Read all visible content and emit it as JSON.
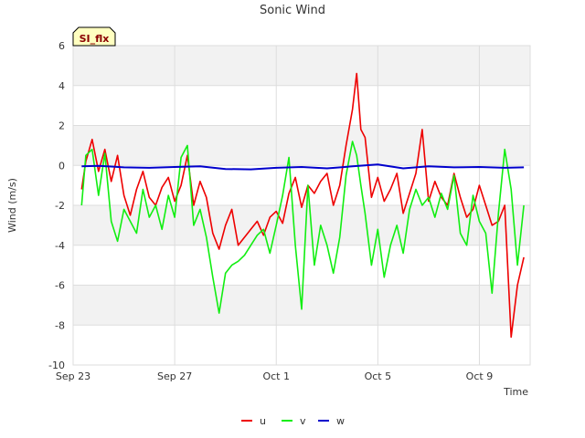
{
  "chart_data": {
    "type": "line",
    "title": "Sonic Wind",
    "xlabel": "Time",
    "ylabel": "Wind (m/s)",
    "badge": "SI_flx",
    "ylim": [
      -10,
      6
    ],
    "yticks": [
      -10,
      -8,
      -6,
      -4,
      -2,
      0,
      2,
      4,
      6
    ],
    "xlim": [
      "2021-09-23",
      "2021-10-11"
    ],
    "xticks": [
      {
        "label": "Sep 23",
        "date": "2021-09-23"
      },
      {
        "label": "Sep 27",
        "date": "2021-09-27"
      },
      {
        "label": "Oct 1",
        "date": "2021-10-01"
      },
      {
        "label": "Oct 5",
        "date": "2021-10-05"
      },
      {
        "label": "Oct 9",
        "date": "2021-10-09"
      }
    ],
    "grid": true,
    "legend_position": "bottom",
    "series": [
      {
        "name": "u",
        "color": "#ee0000",
        "x": [
          "2021-09-23T08:00",
          "2021-09-23T12:00",
          "2021-09-23T18:00",
          "2021-09-24T00:00",
          "2021-09-24T06:00",
          "2021-09-24T12:00",
          "2021-09-24T18:00",
          "2021-09-25T00:00",
          "2021-09-25T06:00",
          "2021-09-25T12:00",
          "2021-09-25T18:00",
          "2021-09-26T00:00",
          "2021-09-26T06:00",
          "2021-09-26T12:00",
          "2021-09-26T18:00",
          "2021-09-27T00:00",
          "2021-09-27T06:00",
          "2021-09-27T12:00",
          "2021-09-27T18:00",
          "2021-09-28T00:00",
          "2021-09-28T06:00",
          "2021-09-28T12:00",
          "2021-09-28T18:00",
          "2021-09-29T00:00",
          "2021-09-29T06:00",
          "2021-09-29T12:00",
          "2021-09-29T18:00",
          "2021-09-30T00:00",
          "2021-09-30T06:00",
          "2021-09-30T12:00",
          "2021-09-30T18:00",
          "2021-10-01T00:00",
          "2021-10-01T06:00",
          "2021-10-01T12:00",
          "2021-10-01T18:00",
          "2021-10-02T00:00",
          "2021-10-02T06:00",
          "2021-10-02T12:00",
          "2021-10-02T18:00",
          "2021-10-03T00:00",
          "2021-10-03T06:00",
          "2021-10-03T12:00",
          "2021-10-03T18:00",
          "2021-10-04T00:00",
          "2021-10-04T04:00",
          "2021-10-04T08:00",
          "2021-10-04T12:00",
          "2021-10-04T18:00",
          "2021-10-05T00:00",
          "2021-10-05T06:00",
          "2021-10-05T12:00",
          "2021-10-05T18:00",
          "2021-10-06T00:00",
          "2021-10-06T06:00",
          "2021-10-06T12:00",
          "2021-10-06T18:00",
          "2021-10-07T00:00",
          "2021-10-07T06:00",
          "2021-10-07T12:00",
          "2021-10-07T18:00",
          "2021-10-08T00:00",
          "2021-10-08T06:00",
          "2021-10-08T12:00",
          "2021-10-08T18:00",
          "2021-10-09T00:00",
          "2021-10-09T06:00",
          "2021-10-09T12:00",
          "2021-10-09T18:00",
          "2021-10-10T00:00",
          "2021-10-10T06:00",
          "2021-10-10T12:00",
          "2021-10-10T18:00"
        ],
        "values": [
          -1.2,
          0.2,
          1.3,
          -0.3,
          0.8,
          -0.8,
          0.5,
          -1.5,
          -2.5,
          -1.2,
          -0.3,
          -1.6,
          -2.0,
          -1.1,
          -0.6,
          -1.8,
          -1.0,
          0.5,
          -2.0,
          -0.8,
          -1.6,
          -3.4,
          -4.2,
          -3.0,
          -2.2,
          -4.0,
          -3.6,
          -3.2,
          -2.8,
          -3.5,
          -2.6,
          -2.3,
          -2.9,
          -1.4,
          -0.6,
          -2.1,
          -1.0,
          -1.4,
          -0.8,
          -0.4,
          -2.0,
          -1.0,
          1.0,
          2.8,
          4.6,
          1.8,
          1.4,
          -1.6,
          -0.6,
          -1.8,
          -1.2,
          -0.4,
          -2.4,
          -1.4,
          -0.4,
          1.8,
          -1.8,
          -0.8,
          -1.6,
          -2.0,
          -0.4,
          -1.6,
          -2.6,
          -2.2,
          -1.0,
          -2.0,
          -3.0,
          -2.8,
          -2.0,
          -8.6,
          -6.0,
          -4.6
        ]
      },
      {
        "name": "v",
        "color": "#11ee11",
        "x": [
          "2021-09-23T08:00",
          "2021-09-23T12:00",
          "2021-09-23T18:00",
          "2021-09-24T00:00",
          "2021-09-24T06:00",
          "2021-09-24T12:00",
          "2021-09-24T18:00",
          "2021-09-25T00:00",
          "2021-09-25T06:00",
          "2021-09-25T12:00",
          "2021-09-25T18:00",
          "2021-09-26T00:00",
          "2021-09-26T06:00",
          "2021-09-26T12:00",
          "2021-09-26T18:00",
          "2021-09-27T00:00",
          "2021-09-27T06:00",
          "2021-09-27T12:00",
          "2021-09-27T18:00",
          "2021-09-28T00:00",
          "2021-09-28T06:00",
          "2021-09-28T12:00",
          "2021-09-28T18:00",
          "2021-09-29T00:00",
          "2021-09-29T06:00",
          "2021-09-29T12:00",
          "2021-09-29T18:00",
          "2021-09-30T00:00",
          "2021-09-30T06:00",
          "2021-09-30T12:00",
          "2021-09-30T18:00",
          "2021-10-01T00:00",
          "2021-10-01T06:00",
          "2021-10-01T12:00",
          "2021-10-01T18:00",
          "2021-10-02T00:00",
          "2021-10-02T06:00",
          "2021-10-02T12:00",
          "2021-10-02T18:00",
          "2021-10-03T00:00",
          "2021-10-03T06:00",
          "2021-10-03T12:00",
          "2021-10-03T18:00",
          "2021-10-04T00:00",
          "2021-10-04T04:00",
          "2021-10-04T08:00",
          "2021-10-04T12:00",
          "2021-10-04T18:00",
          "2021-10-05T00:00",
          "2021-10-05T06:00",
          "2021-10-05T12:00",
          "2021-10-05T18:00",
          "2021-10-06T00:00",
          "2021-10-06T06:00",
          "2021-10-06T12:00",
          "2021-10-06T18:00",
          "2021-10-07T00:00",
          "2021-10-07T06:00",
          "2021-10-07T12:00",
          "2021-10-07T18:00",
          "2021-10-08T00:00",
          "2021-10-08T06:00",
          "2021-10-08T12:00",
          "2021-10-08T18:00",
          "2021-10-09T00:00",
          "2021-10-09T06:00",
          "2021-10-09T12:00",
          "2021-10-09T18:00",
          "2021-10-10T00:00",
          "2021-10-10T06:00",
          "2021-10-10T12:00",
          "2021-10-10T18:00"
        ],
        "values": [
          -2.0,
          0.5,
          0.8,
          -1.5,
          0.6,
          -2.8,
          -3.8,
          -2.2,
          -2.8,
          -3.4,
          -1.2,
          -2.6,
          -2.0,
          -3.2,
          -1.5,
          -2.6,
          0.4,
          1.0,
          -3.0,
          -2.2,
          -3.6,
          -5.6,
          -7.4,
          -5.4,
          -5.0,
          -4.8,
          -4.5,
          -4.0,
          -3.5,
          -3.2,
          -4.4,
          -3.0,
          -1.5,
          0.4,
          -4.0,
          -7.2,
          -1.0,
          -5.0,
          -3.0,
          -4.0,
          -5.4,
          -3.6,
          -0.5,
          1.2,
          0.5,
          -1.0,
          -2.4,
          -5.0,
          -3.2,
          -5.6,
          -4.0,
          -3.0,
          -4.4,
          -2.2,
          -1.2,
          -2.0,
          -1.6,
          -2.6,
          -1.4,
          -2.2,
          -0.5,
          -3.4,
          -4.0,
          -1.5,
          -2.8,
          -3.4,
          -6.4,
          -2.4,
          0.8,
          -1.2,
          -5.0,
          -2.0
        ]
      },
      {
        "name": "w",
        "color": "#0000cc",
        "x": [
          "2021-09-23T08:00",
          "2021-09-24T00:00",
          "2021-09-25T00:00",
          "2021-09-26T00:00",
          "2021-09-27T00:00",
          "2021-09-28T00:00",
          "2021-09-29T00:00",
          "2021-09-30T00:00",
          "2021-10-01T00:00",
          "2021-10-02T00:00",
          "2021-10-03T00:00",
          "2021-10-04T00:00",
          "2021-10-05T00:00",
          "2021-10-06T00:00",
          "2021-10-07T00:00",
          "2021-10-08T00:00",
          "2021-10-09T00:00",
          "2021-10-10T00:00",
          "2021-10-10T18:00"
        ],
        "values": [
          -0.05,
          -0.02,
          -0.1,
          -0.12,
          -0.08,
          -0.05,
          -0.18,
          -0.2,
          -0.12,
          -0.08,
          -0.15,
          -0.05,
          0.05,
          -0.15,
          -0.05,
          -0.1,
          -0.08,
          -0.12,
          -0.1
        ]
      }
    ]
  }
}
